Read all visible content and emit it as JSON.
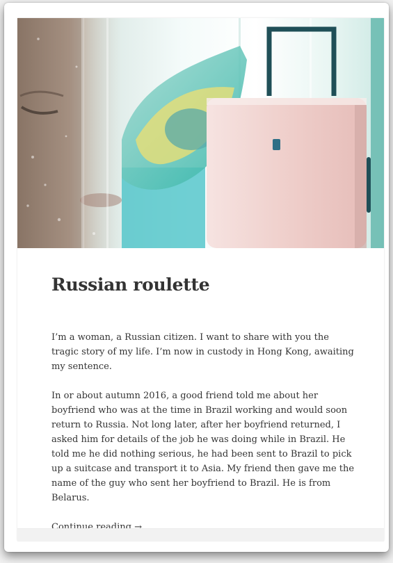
{
  "post": {
    "title": "Russian roulette",
    "paragraphs": [
      "I’m a woman, a Russian citizen. I want to share with you the tragic story of my life. I’m now in custody in Hong Kong, awaiting my sentence.",
      "In or about autumn 2016, a good friend told me about her boyfriend who was at the time in Brazil working and would soon return to Russia. Not long later, after her boyfriend returned, I asked him for details of the job he was doing while in Brazil. He told me he did nothing serious, he had been sent to Brazil to pick up a suitcase and transport it to Asia. My friend then gave me the name of the guy who sent her boyfriend to Brazil. He is from Belarus."
    ],
    "continue_label": "Continue reading",
    "continue_arrow": "→"
  },
  "colors": {
    "page_bg": "#f1f1f1",
    "card_bg": "#ffffff",
    "text": "#333333"
  },
  "hero_image": {
    "subject": "collage of a woman's face behind a wet window, a waving Brazilian flag and a pink suitcase"
  }
}
